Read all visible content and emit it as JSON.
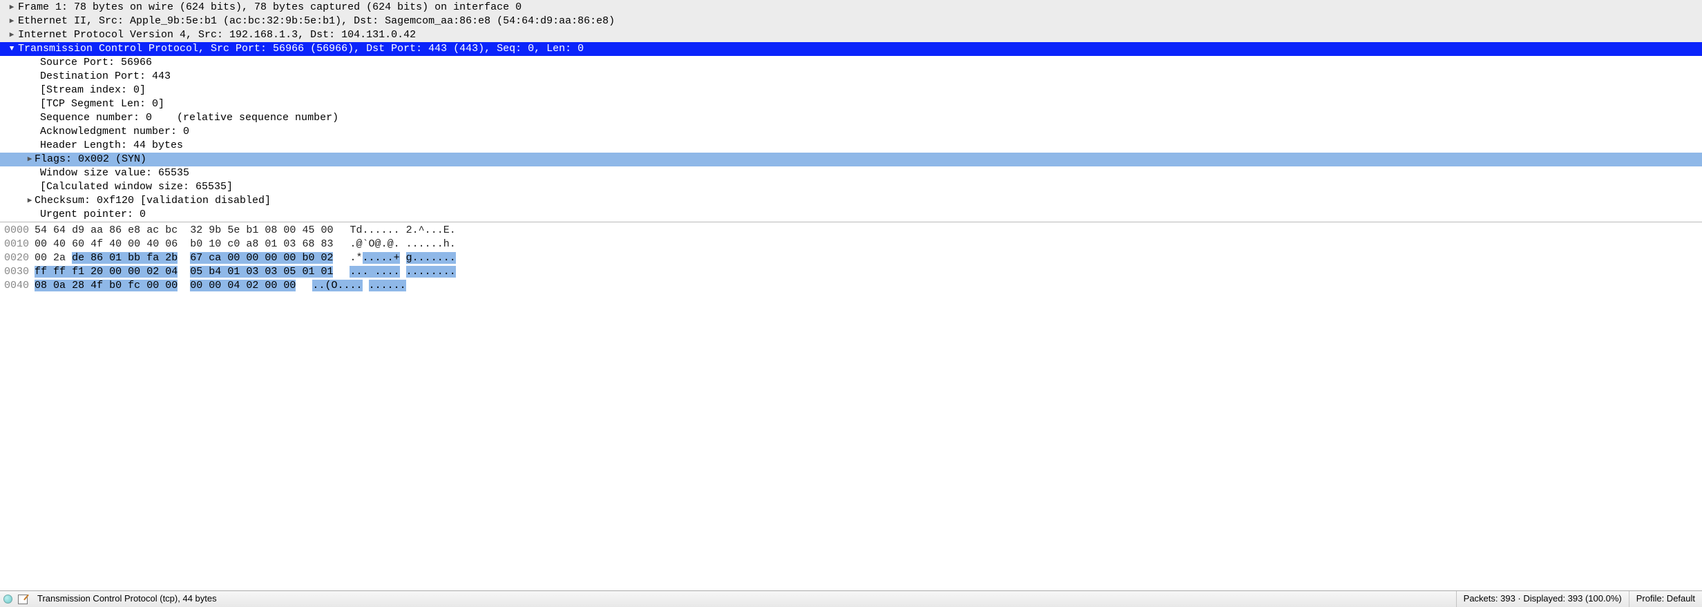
{
  "tree": {
    "frame": "Frame 1: 78 bytes on wire (624 bits), 78 bytes captured (624 bits) on interface 0",
    "eth": "Ethernet II, Src: Apple_9b:5e:b1 (ac:bc:32:9b:5e:b1), Dst: Sagemcom_aa:86:e8 (54:64:d9:aa:86:e8)",
    "ip": "Internet Protocol Version 4, Src: 192.168.1.3, Dst: 104.131.0.42",
    "tcp": "Transmission Control Protocol, Src Port: 56966 (56966), Dst Port: 443 (443), Seq: 0, Len: 0",
    "tcp_children": {
      "srcport": "Source Port: 56966",
      "dstport": "Destination Port: 443",
      "stream": "[Stream index: 0]",
      "seglen": "[TCP Segment Len: 0]",
      "seqnum": "Sequence number: 0    (relative sequence number)",
      "acknum": "Acknowledgment number: 0",
      "hdrlen": "Header Length: 44 bytes",
      "flags": "Flags: 0x002 (SYN)",
      "winsize": "Window size value: 65535",
      "calcwin": "[Calculated window size: 65535]",
      "checksum": "Checksum: 0xf120 [validation disabled]",
      "urgent": "Urgent pointer: 0"
    }
  },
  "hex": [
    {
      "offset": "0000",
      "bytes": "54 64 d9 aa 86 e8 ac bc  32 9b 5e b1 08 00 45 00",
      "ascii": "Td...... 2.^...E."
    },
    {
      "offset": "0010",
      "bytes": "00 40 60 4f 40 00 40 06  b0 10 c0 a8 01 03 68 83",
      "ascii": ".@`O@.@. ......h."
    },
    {
      "offset": "0020",
      "bytes": "00 2a de 86 01 bb fa 2b  67 ca 00 00 00 00 b0 02",
      "ascii": ".*.....+ g......."
    },
    {
      "offset": "0030",
      "bytes": "ff ff f1 20 00 00 02 04  05 b4 01 03 03 05 01 01",
      "ascii": "... .... ........"
    },
    {
      "offset": "0040",
      "bytes": "08 0a 28 4f b0 fc 00 00  00 00 04 02 00 00",
      "ascii": "..(O.... ......"
    }
  ],
  "highlight": {
    "start": 34,
    "end": 78
  },
  "status": {
    "proto": "Transmission Control Protocol (tcp), 44 bytes",
    "packets": "Packets: 393 · Displayed: 393 (100.0%)",
    "profile": "Profile: Default"
  }
}
